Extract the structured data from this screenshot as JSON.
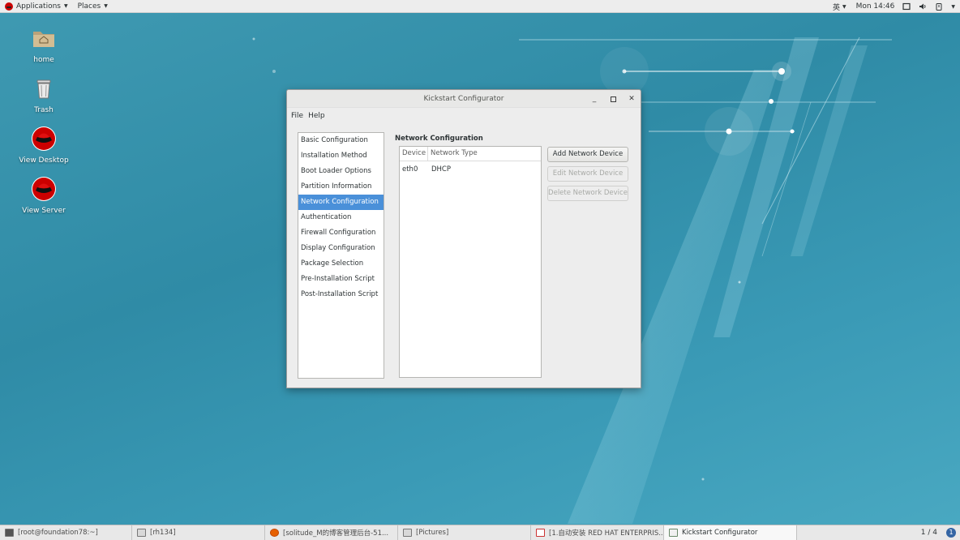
{
  "topbar": {
    "applications_label": "Applications",
    "places_label": "Places",
    "input_method": "英",
    "clock": "Mon 14:46"
  },
  "desktop_icons": [
    {
      "label": "home",
      "icon": "folder-home-icon"
    },
    {
      "label": "Trash",
      "icon": "trash-icon"
    },
    {
      "label": "View Desktop",
      "icon": "redhat-icon"
    },
    {
      "label": "View Server",
      "icon": "redhat-icon"
    }
  ],
  "window": {
    "title": "Kickstart Configurator",
    "menu": {
      "file": "File",
      "help": "Help"
    },
    "sidebar": {
      "items": [
        {
          "label": "Basic Configuration"
        },
        {
          "label": "Installation Method"
        },
        {
          "label": "Boot Loader Options"
        },
        {
          "label": "Partition Information"
        },
        {
          "label": "Network Configuration"
        },
        {
          "label": "Authentication"
        },
        {
          "label": "Firewall Configuration"
        },
        {
          "label": "Display Configuration"
        },
        {
          "label": "Package Selection"
        },
        {
          "label": "Pre-Installation Script"
        },
        {
          "label": "Post-Installation Script"
        }
      ],
      "selected": "Network Configuration"
    },
    "section_title": "Network Configuration",
    "table": {
      "columns": [
        "Device",
        "Network Type"
      ],
      "rows": [
        [
          "eth0",
          "DHCP"
        ]
      ]
    },
    "buttons": {
      "add": "Add Network Device",
      "edit": "Edit Network Device",
      "delete": "Delete Network Device"
    }
  },
  "taskbar": {
    "tasks": [
      {
        "label": "[root@foundation78:~]"
      },
      {
        "label": "[rh134]"
      },
      {
        "label": "[solitude_M的博客管理后台-51..."
      },
      {
        "label": "[Pictures]"
      },
      {
        "label": "[1.自动安装 RED HAT ENTERPRIS..."
      },
      {
        "label": "Kickstart Configurator"
      }
    ],
    "active_task": "Kickstart Configurator",
    "pager": "1 / 4"
  }
}
